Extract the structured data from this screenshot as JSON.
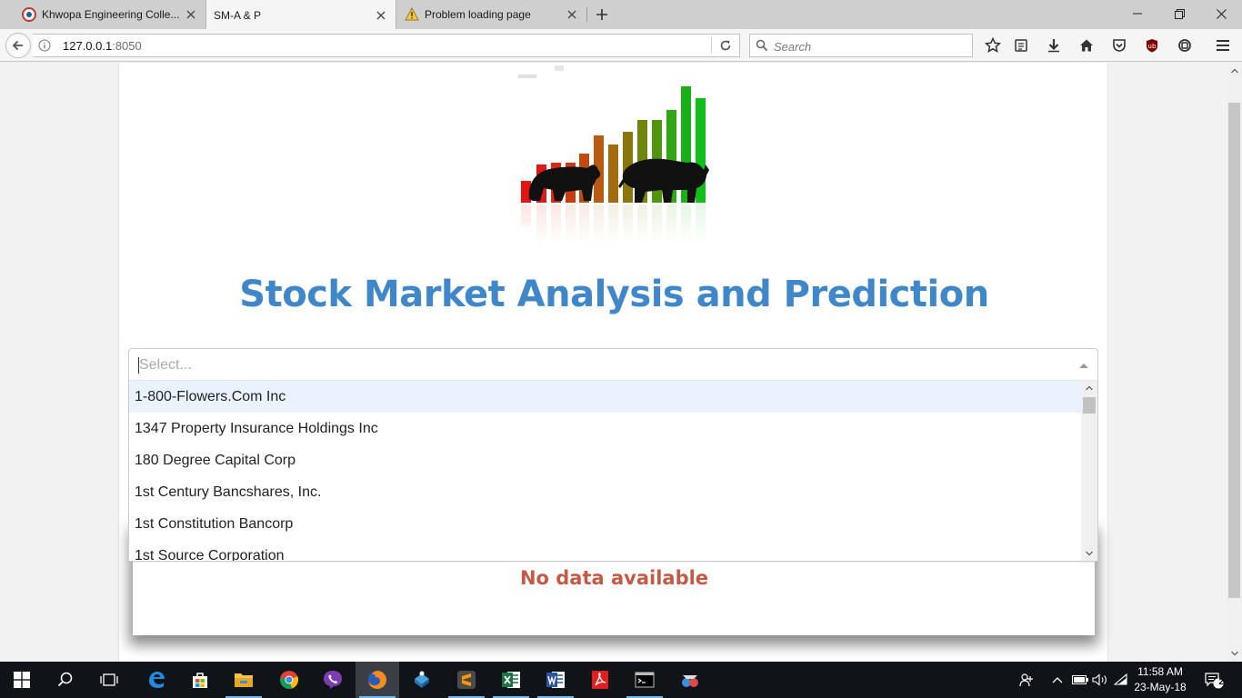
{
  "browser": {
    "tabs": [
      {
        "title": "Khwopa Engineering Colle...",
        "active": false
      },
      {
        "title": "SM-A & P",
        "active": true
      },
      {
        "title": "Problem loading page",
        "active": false
      }
    ],
    "url_host": "127.0.0.1",
    "url_port": ":8050",
    "search_placeholder": "Search"
  },
  "page": {
    "title": "Stock Market Analysis and Prediction",
    "dropdown": {
      "placeholder": "Select...",
      "options": [
        "1-800-Flowers.Com Inc",
        "1347 Property Insurance Holdings Inc",
        "180 Degree Capital Corp",
        "1st Century Bancshares, Inc.",
        "1st Constitution Bancorp",
        "1st Source Corporation"
      ],
      "focused_index": 0
    },
    "empty_message": "No data available",
    "colors": {
      "title": "#3f87c8",
      "empty_message": "#c25a47",
      "option_focus": "#eaf3fd"
    }
  },
  "taskbar": {
    "time": "11:58 AM",
    "date": "23-May-18",
    "notification_count": "2"
  }
}
